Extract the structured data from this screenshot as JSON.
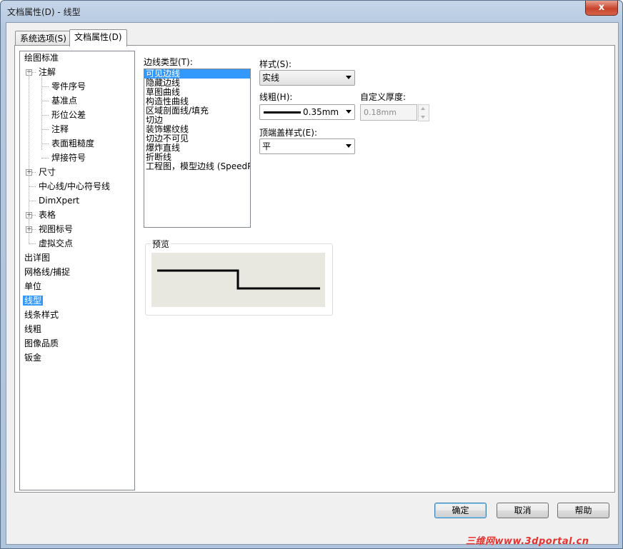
{
  "window": {
    "title": "文档属性(D) - 线型",
    "close_glyph": "x"
  },
  "tabs": [
    {
      "label": "系统选项(S)",
      "active": false
    },
    {
      "label": "文档属性(D)",
      "active": true
    }
  ],
  "tree": {
    "expand_glyph": "+",
    "collapse_glyph": "−",
    "items": [
      {
        "label": "绘图标准",
        "level": 0,
        "expander": "none"
      },
      {
        "label": "注解",
        "level": 1,
        "expander": "minus"
      },
      {
        "label": "零件序号",
        "level": 2,
        "expander": "none"
      },
      {
        "label": "基准点",
        "level": 2,
        "expander": "none"
      },
      {
        "label": "形位公差",
        "level": 2,
        "expander": "none"
      },
      {
        "label": "注释",
        "level": 2,
        "expander": "none"
      },
      {
        "label": "表面粗糙度",
        "level": 2,
        "expander": "none"
      },
      {
        "label": "焊接符号",
        "level": 2,
        "expander": "none"
      },
      {
        "label": "尺寸",
        "level": 1,
        "expander": "plus"
      },
      {
        "label": "中心线/中心符号线",
        "level": 1,
        "expander": "none"
      },
      {
        "label": "DimXpert",
        "level": 1,
        "expander": "none"
      },
      {
        "label": "表格",
        "level": 1,
        "expander": "plus"
      },
      {
        "label": "视图标号",
        "level": 1,
        "expander": "plus"
      },
      {
        "label": "虚拟交点",
        "level": 1,
        "expander": "none"
      },
      {
        "label": "出详图",
        "level": 0,
        "expander": "none"
      },
      {
        "label": "网格线/捕捉",
        "level": 0,
        "expander": "none"
      },
      {
        "label": "单位",
        "level": 0,
        "expander": "none"
      },
      {
        "label": "线型",
        "level": 0,
        "expander": "none",
        "selected": true
      },
      {
        "label": "线条样式",
        "level": 0,
        "expander": "none"
      },
      {
        "label": "线粗",
        "level": 0,
        "expander": "none"
      },
      {
        "label": "图像品质",
        "level": 0,
        "expander": "none"
      },
      {
        "label": "钣金",
        "level": 0,
        "expander": "none"
      }
    ]
  },
  "edge_types": {
    "label": "边线类型(T):",
    "items": [
      {
        "label": "可见边线",
        "selected": true
      },
      {
        "label": "隐藏边线"
      },
      {
        "label": "草图曲线"
      },
      {
        "label": "构造性曲线"
      },
      {
        "label": "区域剖面线/填充"
      },
      {
        "label": "切边"
      },
      {
        "label": "装饰螺纹线"
      },
      {
        "label": "切边不可见"
      },
      {
        "label": "爆炸直线"
      },
      {
        "label": "折断线"
      },
      {
        "label": "工程图，模型边线 (SpeedPa"
      }
    ]
  },
  "style": {
    "label": "样式(S):",
    "value": "实线"
  },
  "thickness": {
    "label": "线粗(H):",
    "value": "0.35mm"
  },
  "custom_thickness": {
    "label": "自定义厚度:",
    "value": "0.18mm"
  },
  "end_cap": {
    "label": "顶端盖样式(E):",
    "value": "平"
  },
  "preview": {
    "label": "预览"
  },
  "buttons": {
    "ok": "确定",
    "cancel": "取消",
    "help": "帮助"
  },
  "watermark": "三维网www.3dportal.cn",
  "colors": {
    "selection": "#3399ff",
    "preview_bg": "#e8e7e0",
    "close_button": "#c8432c"
  }
}
